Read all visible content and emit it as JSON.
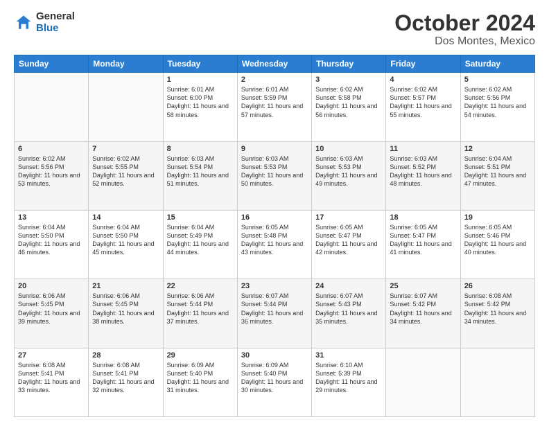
{
  "header": {
    "logo_general": "General",
    "logo_blue": "Blue",
    "month_title": "October 2024",
    "location": "Dos Montes, Mexico"
  },
  "days_of_week": [
    "Sunday",
    "Monday",
    "Tuesday",
    "Wednesday",
    "Thursday",
    "Friday",
    "Saturday"
  ],
  "weeks": [
    [
      {
        "day": "",
        "text": ""
      },
      {
        "day": "",
        "text": ""
      },
      {
        "day": "1",
        "text": "Sunrise: 6:01 AM\nSunset: 6:00 PM\nDaylight: 11 hours and 58 minutes."
      },
      {
        "day": "2",
        "text": "Sunrise: 6:01 AM\nSunset: 5:59 PM\nDaylight: 11 hours and 57 minutes."
      },
      {
        "day": "3",
        "text": "Sunrise: 6:02 AM\nSunset: 5:58 PM\nDaylight: 11 hours and 56 minutes."
      },
      {
        "day": "4",
        "text": "Sunrise: 6:02 AM\nSunset: 5:57 PM\nDaylight: 11 hours and 55 minutes."
      },
      {
        "day": "5",
        "text": "Sunrise: 6:02 AM\nSunset: 5:56 PM\nDaylight: 11 hours and 54 minutes."
      }
    ],
    [
      {
        "day": "6",
        "text": "Sunrise: 6:02 AM\nSunset: 5:56 PM\nDaylight: 11 hours and 53 minutes."
      },
      {
        "day": "7",
        "text": "Sunrise: 6:02 AM\nSunset: 5:55 PM\nDaylight: 11 hours and 52 minutes."
      },
      {
        "day": "8",
        "text": "Sunrise: 6:03 AM\nSunset: 5:54 PM\nDaylight: 11 hours and 51 minutes."
      },
      {
        "day": "9",
        "text": "Sunrise: 6:03 AM\nSunset: 5:53 PM\nDaylight: 11 hours and 50 minutes."
      },
      {
        "day": "10",
        "text": "Sunrise: 6:03 AM\nSunset: 5:53 PM\nDaylight: 11 hours and 49 minutes."
      },
      {
        "day": "11",
        "text": "Sunrise: 6:03 AM\nSunset: 5:52 PM\nDaylight: 11 hours and 48 minutes."
      },
      {
        "day": "12",
        "text": "Sunrise: 6:04 AM\nSunset: 5:51 PM\nDaylight: 11 hours and 47 minutes."
      }
    ],
    [
      {
        "day": "13",
        "text": "Sunrise: 6:04 AM\nSunset: 5:50 PM\nDaylight: 11 hours and 46 minutes."
      },
      {
        "day": "14",
        "text": "Sunrise: 6:04 AM\nSunset: 5:50 PM\nDaylight: 11 hours and 45 minutes."
      },
      {
        "day": "15",
        "text": "Sunrise: 6:04 AM\nSunset: 5:49 PM\nDaylight: 11 hours and 44 minutes."
      },
      {
        "day": "16",
        "text": "Sunrise: 6:05 AM\nSunset: 5:48 PM\nDaylight: 11 hours and 43 minutes."
      },
      {
        "day": "17",
        "text": "Sunrise: 6:05 AM\nSunset: 5:47 PM\nDaylight: 11 hours and 42 minutes."
      },
      {
        "day": "18",
        "text": "Sunrise: 6:05 AM\nSunset: 5:47 PM\nDaylight: 11 hours and 41 minutes."
      },
      {
        "day": "19",
        "text": "Sunrise: 6:05 AM\nSunset: 5:46 PM\nDaylight: 11 hours and 40 minutes."
      }
    ],
    [
      {
        "day": "20",
        "text": "Sunrise: 6:06 AM\nSunset: 5:45 PM\nDaylight: 11 hours and 39 minutes."
      },
      {
        "day": "21",
        "text": "Sunrise: 6:06 AM\nSunset: 5:45 PM\nDaylight: 11 hours and 38 minutes."
      },
      {
        "day": "22",
        "text": "Sunrise: 6:06 AM\nSunset: 5:44 PM\nDaylight: 11 hours and 37 minutes."
      },
      {
        "day": "23",
        "text": "Sunrise: 6:07 AM\nSunset: 5:44 PM\nDaylight: 11 hours and 36 minutes."
      },
      {
        "day": "24",
        "text": "Sunrise: 6:07 AM\nSunset: 5:43 PM\nDaylight: 11 hours and 35 minutes."
      },
      {
        "day": "25",
        "text": "Sunrise: 6:07 AM\nSunset: 5:42 PM\nDaylight: 11 hours and 34 minutes."
      },
      {
        "day": "26",
        "text": "Sunrise: 6:08 AM\nSunset: 5:42 PM\nDaylight: 11 hours and 34 minutes."
      }
    ],
    [
      {
        "day": "27",
        "text": "Sunrise: 6:08 AM\nSunset: 5:41 PM\nDaylight: 11 hours and 33 minutes."
      },
      {
        "day": "28",
        "text": "Sunrise: 6:08 AM\nSunset: 5:41 PM\nDaylight: 11 hours and 32 minutes."
      },
      {
        "day": "29",
        "text": "Sunrise: 6:09 AM\nSunset: 5:40 PM\nDaylight: 11 hours and 31 minutes."
      },
      {
        "day": "30",
        "text": "Sunrise: 6:09 AM\nSunset: 5:40 PM\nDaylight: 11 hours and 30 minutes."
      },
      {
        "day": "31",
        "text": "Sunrise: 6:10 AM\nSunset: 5:39 PM\nDaylight: 11 hours and 29 minutes."
      },
      {
        "day": "",
        "text": ""
      },
      {
        "day": "",
        "text": ""
      }
    ]
  ]
}
